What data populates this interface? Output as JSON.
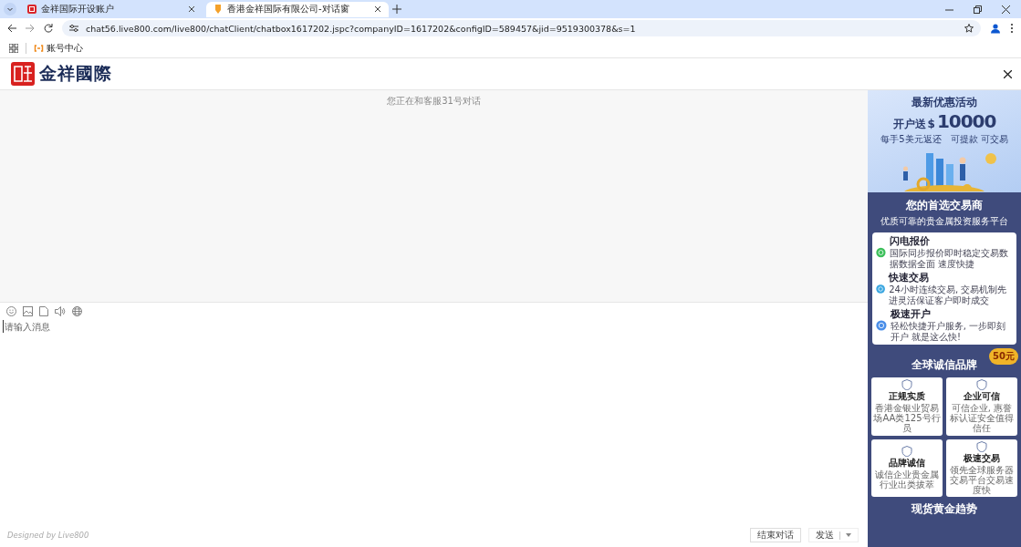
{
  "browser": {
    "tabs": [
      {
        "title": "金祥国际开设账户",
        "selected": false
      },
      {
        "title": "香港金祥国际有限公司-对话窗",
        "selected": true
      }
    ],
    "url": "chat56.live800.com/live800/chatClient/chatbox1617202.jspc?companyID=1617202&configID=589457&jid=9519300378&s=1",
    "bookmarks": [
      {
        "label": "账号中心"
      }
    ]
  },
  "header": {
    "logo_text": "金祥國際"
  },
  "chat": {
    "notice": "您正在和客服31号对话",
    "input": {
      "placeholder": "请输入消息"
    },
    "credit": "Designed by Live800",
    "buttons": [
      {
        "label": "结束对话",
        "kind": "plain"
      },
      {
        "label": "发送",
        "kind": "split"
      }
    ]
  },
  "ad": {
    "promo_title": "最新优惠活动",
    "offer": "开户送",
    "currency": "$",
    "amount": "10000",
    "taglines": [
      "每手5美元返还",
      "可提款 可交易"
    ],
    "section_title": "您的首选交易商",
    "section_subtitle": "优质可靠的贵金属投资服务平台",
    "features": [
      {
        "title": "闪电报价",
        "desc": "国际同步报价即时稳定交易数据数据全面 速度快捷",
        "color": "#3cbf5a"
      },
      {
        "title": "快速交易",
        "desc": "24小时连续交易, 交易机制先进灵活保证客户即时成交",
        "color": "#3aa6e0"
      },
      {
        "title": "极速开户",
        "desc": "轻松快捷开户服务, 一步即刻开户 就是这么快!",
        "color": "#4a8ee8"
      }
    ],
    "badge": "50元",
    "brand_title": "全球诚信品牌",
    "cards": [
      {
        "title": "正规实质",
        "desc": "香港金银业贸易场AA类125号行员"
      },
      {
        "title": "企业可信",
        "desc": "可信企业, 惠誉标认证安全值得信任"
      },
      {
        "title": "品牌诚信",
        "desc": "诚信企业贵金属行业出类拔萃"
      },
      {
        "title": "极速交易",
        "desc": "领先全球服务器交易平台交易速度快"
      }
    ],
    "next_title": "现货黄金趋势"
  }
}
